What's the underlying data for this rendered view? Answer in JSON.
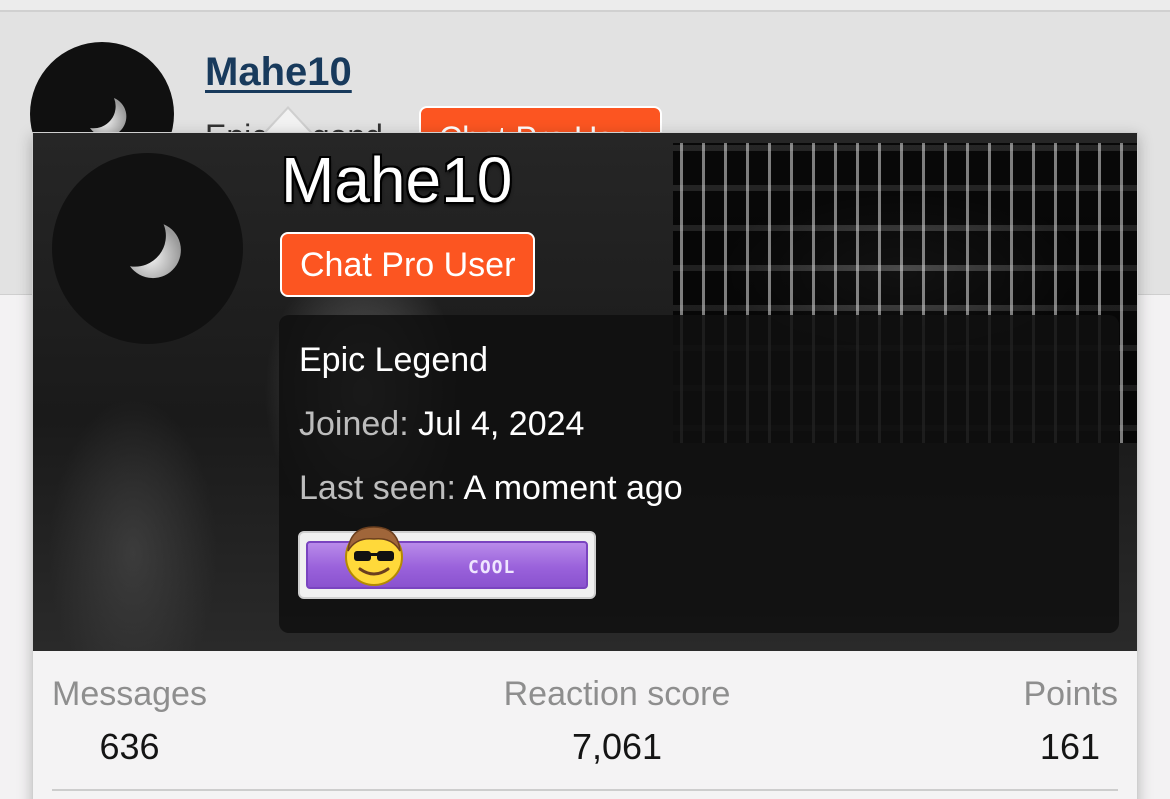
{
  "background": {
    "username": "Mahe10",
    "user_title": "Epic Legend",
    "banner": "Chat Pro User"
  },
  "card": {
    "username": "Mahe10",
    "banner": "Chat Pro User",
    "user_title": "Epic Legend",
    "joined_label": "Joined:",
    "joined_value": "Jul 4, 2024",
    "last_seen_label": "Last seen:",
    "last_seen_value": "A moment ago",
    "badge": {
      "label": "COOL",
      "icon": "sunglasses-smiley-icon"
    }
  },
  "stats": [
    {
      "label": "Messages",
      "value": "636"
    },
    {
      "label": "Reaction score",
      "value": "7,061"
    },
    {
      "label": "Points",
      "value": "161"
    }
  ],
  "colors": {
    "banner": "#fc5521",
    "username_link": "#183a5c",
    "badge_purple": "#9a62db"
  }
}
